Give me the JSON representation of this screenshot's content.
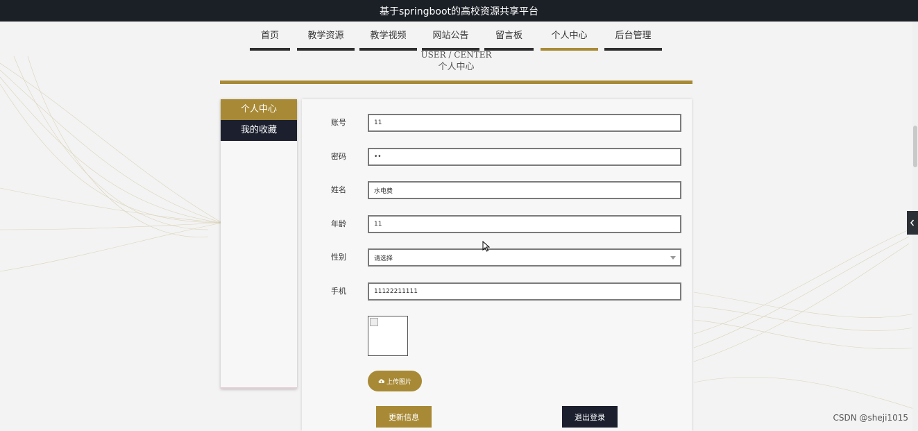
{
  "header": {
    "title": "基于springboot的高校资源共享平台"
  },
  "nav": {
    "items": [
      {
        "label": "首页"
      },
      {
        "label": "教学资源"
      },
      {
        "label": "教学视频"
      },
      {
        "label": "网站公告"
      },
      {
        "label": "留言板"
      },
      {
        "label": "个人中心"
      },
      {
        "label": "后台管理"
      }
    ],
    "active": "个人中心"
  },
  "page": {
    "title_en": "USER / CENTER",
    "title_zh": "个人中心"
  },
  "sidebar": {
    "items": [
      {
        "label": "个人中心"
      },
      {
        "label": "我的收藏"
      }
    ],
    "active": "个人中心"
  },
  "form": {
    "fields": [
      {
        "label": "账号",
        "value": "11"
      },
      {
        "label": "密码",
        "value": "••"
      },
      {
        "label": "姓名",
        "value": "水电费"
      },
      {
        "label": "年龄",
        "value": "11"
      },
      {
        "label": "性别",
        "value": "请选择"
      },
      {
        "label": "手机",
        "value": "11122211111"
      }
    ],
    "upload_label": "上传图片",
    "update_label": "更新信息",
    "logout_label": "退出登录"
  },
  "colors": {
    "accent": "#a88a36",
    "dark": "#1b1f2e",
    "titlebar": "#1b1f26"
  },
  "watermark": "CSDN @sheji1015"
}
